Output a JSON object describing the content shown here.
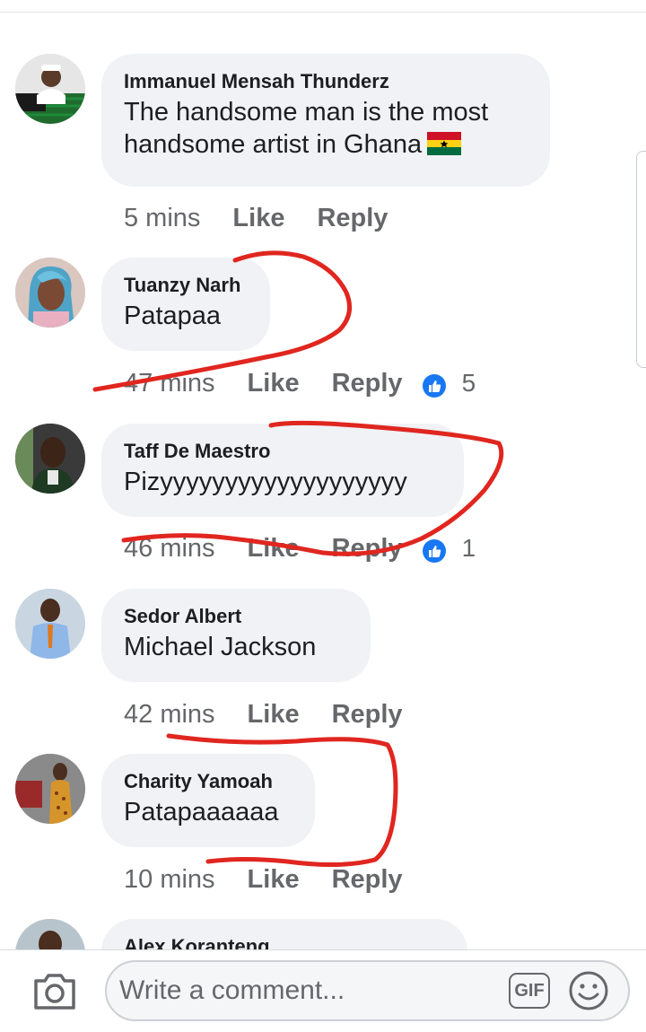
{
  "comments": [
    {
      "author": "Immanuel Mensah Thunderz",
      "text": "The handsome man is the most handsome artist in Ghana",
      "has_flag": true,
      "time": "5 mins",
      "like": "Like",
      "reply": "Reply"
    },
    {
      "author": "Tuanzy Narh",
      "text": "Patapaa",
      "time": "47 mins",
      "like": "Like",
      "reply": "Reply",
      "reactions": "5"
    },
    {
      "author": "Taff De Maestro",
      "text": "Pizyyyyyyyyyyyyyyyyyyy",
      "time": "46 mins",
      "like": "Like",
      "reply": "Reply",
      "reactions": "1"
    },
    {
      "author": "Sedor Albert",
      "text": "Michael Jackson",
      "time": "42 mins",
      "like": "Like",
      "reply": "Reply"
    },
    {
      "author": "Charity Yamoah",
      "text": "Patapaaaaaa",
      "time": "10 mins",
      "like": "Like",
      "reply": "Reply"
    },
    {
      "author": "Alex Koranteng",
      "text": ""
    }
  ],
  "composer": {
    "placeholder": "Write a comment...",
    "gif_label": "GIF"
  },
  "icons": {
    "camera": "camera-icon",
    "gif": "gif-icon",
    "emoji": "smiley-icon",
    "reaction": "like-reaction-icon",
    "flag": "ghana-flag-icon"
  },
  "colors": {
    "bubble": "#f0f2f5",
    "meta_text": "#65676b",
    "like_blue": "#1877f2",
    "annotation_red": "#e0261f"
  }
}
